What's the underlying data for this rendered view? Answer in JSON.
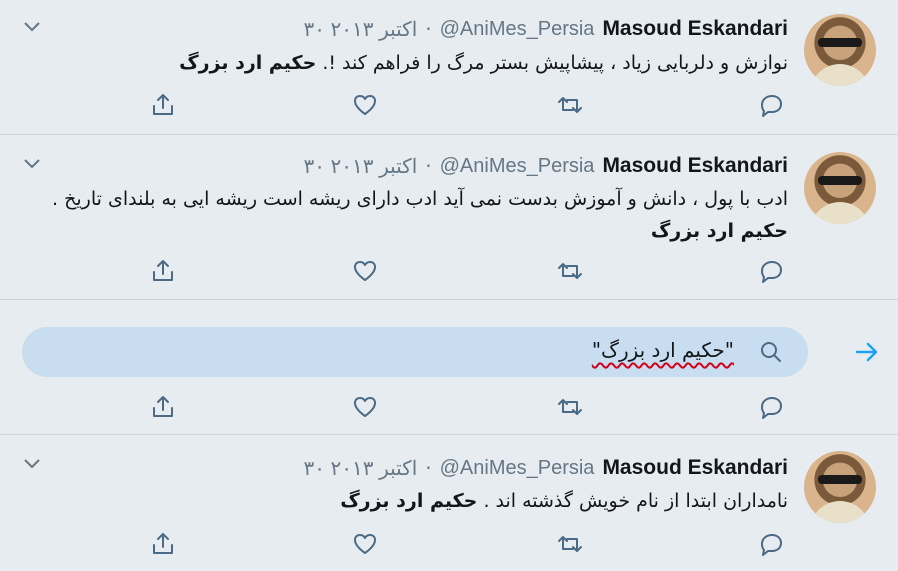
{
  "tweets": [
    {
      "name": "Masoud Eskandari",
      "handle": "@AniMes_Persia",
      "date": "۳۰ اکتبر ۲۰۱۳",
      "text": "نوازش و دلربایی زیاد ، پیشاپیش بستر مرگ را فراهم کند !.",
      "signature": "حکیم ارد بزرگ"
    },
    {
      "name": "Masoud Eskandari",
      "handle": "@AniMes_Persia",
      "date": "۳۰ اکتبر ۲۰۱۳",
      "text": "ادب با پول ، دانش و آموزش بدست نمی آید ادب دارای ریشه است ریشه ایی به بلندای تاریخ .",
      "signature": "حکیم ارد بزرگ"
    },
    {
      "name": "Masoud Eskandari",
      "handle": "@AniMes_Persia",
      "date": "۳۰ اکتبر ۲۰۱۳",
      "text": "نامداران ابتدا از نام خویش گذشته اند .",
      "signature": "حکیم ارد بزرگ"
    }
  ],
  "search": {
    "query": "\"حکیم ارد بزرگ\""
  },
  "colors": {
    "background": "#e6ecf0",
    "icon": "#4a6a86",
    "accent": "#1da1f2",
    "search_bg": "#c8def0"
  }
}
